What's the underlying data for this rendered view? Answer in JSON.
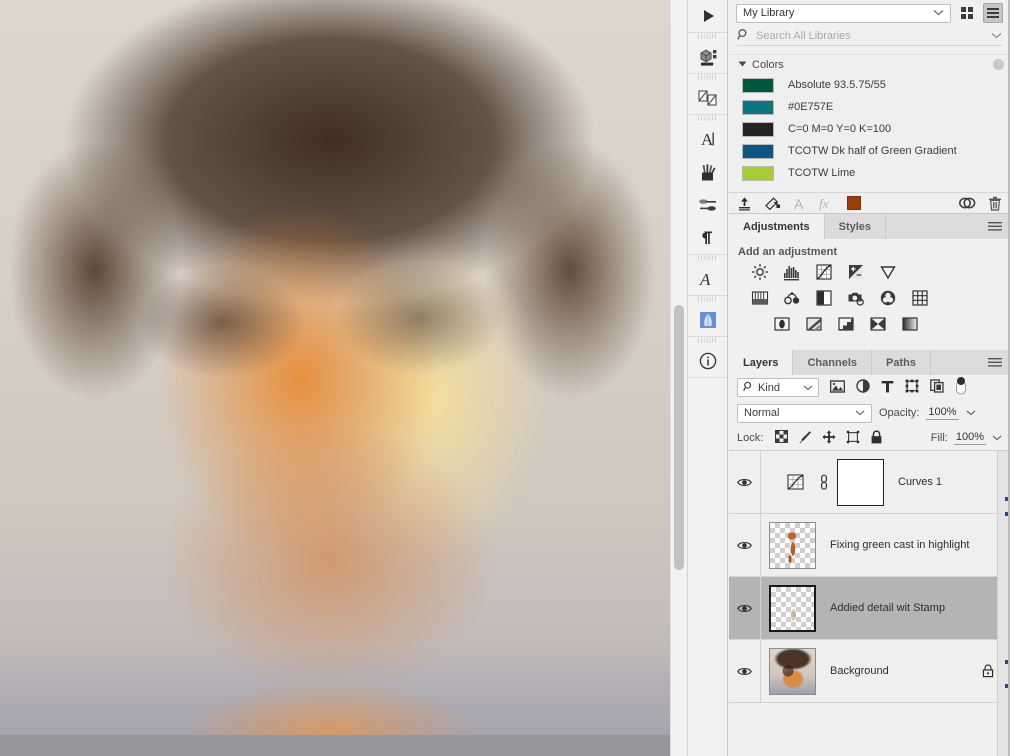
{
  "app": "Adobe Photoshop",
  "canvas": {
    "name": "portrait-photo",
    "description": "Close-up portrait of a curly-haired boy with orange/amber color cast retouching"
  },
  "icon_dock": {
    "items": [
      {
        "name": "play-button",
        "icon": "play-icon",
        "label": "Play"
      },
      {
        "name": "3d-panel",
        "icon": "cube-icon",
        "label": "3D"
      },
      {
        "name": "layer-comps-panel",
        "icon": "layer-comps-icon",
        "label": "Layer Comps"
      },
      {
        "name": "character-panel",
        "icon": "character-a-icon",
        "label": "Character"
      },
      {
        "name": "brushes-panel",
        "icon": "brushes-icon",
        "label": "Brushes"
      },
      {
        "name": "brush-settings-panel",
        "icon": "brush-settings-icon",
        "label": "Brush Settings"
      },
      {
        "name": "paragraph-panel",
        "icon": "pilcrow-icon",
        "label": "Paragraph"
      },
      {
        "name": "glyphs-panel",
        "icon": "script-a-icon",
        "label": "Glyphs"
      },
      {
        "name": "libraries-panel",
        "icon": "libraries-thumbnail-icon",
        "label": "Libraries"
      },
      {
        "name": "info-panel",
        "icon": "info-circle-icon",
        "label": "Info"
      }
    ]
  },
  "libraries": {
    "selected_library": "My Library",
    "view_grid_label": "Grid view",
    "view_list_label": "List view",
    "active_view": "list",
    "search_placeholder": "Search All Libraries",
    "group_title": "Colors",
    "group_expanded": true,
    "items": [
      {
        "label": "Absolute 93.5.75/55",
        "color": "#05563f"
      },
      {
        "label": "#0E757E",
        "color": "#0e757e"
      },
      {
        "label": "C=0 M=0 Y=0 K=100",
        "color": "#242424"
      },
      {
        "label": "TCOTW Dk half of Green Gradient",
        "color": "#105480"
      },
      {
        "label": "TCOTW Lime",
        "color": "#a8cc38"
      }
    ],
    "toolbar": {
      "upload_label": "Add content",
      "graphic_label": "Add graphic",
      "text_style_label": "Add character style",
      "layer_style_label": "Add layer style",
      "color_label": "Add fill color",
      "color_value": "#9e3d0b",
      "creative_cloud_label": "Creative Cloud",
      "delete_label": "Delete"
    }
  },
  "adjustments": {
    "tabs": [
      {
        "label": "Adjustments",
        "active": true
      },
      {
        "label": "Styles",
        "active": false
      }
    ],
    "menu_label": "Panel menu",
    "heading": "Add an adjustment",
    "row1": [
      {
        "name": "brightness-contrast-adjustment",
        "icon": "sun-icon"
      },
      {
        "name": "levels-adjustment",
        "icon": "levels-icon"
      },
      {
        "name": "curves-adjustment",
        "icon": "curves-icon"
      },
      {
        "name": "exposure-adjustment",
        "icon": "exposure-icon"
      },
      {
        "name": "vibrance-adjustment",
        "icon": "triangle-icon"
      }
    ],
    "row2": [
      {
        "name": "hue-saturation-adjustment",
        "icon": "hue-saturation-icon"
      },
      {
        "name": "color-balance-adjustment",
        "icon": "balance-scale-icon"
      },
      {
        "name": "black-white-adjustment",
        "icon": "half-square-icon"
      },
      {
        "name": "photo-filter-adjustment",
        "icon": "camera-icon"
      },
      {
        "name": "channel-mixer-adjustment",
        "icon": "color-wheel-icon"
      },
      {
        "name": "color-lookup-adjustment",
        "icon": "grid-icon"
      }
    ],
    "row3": [
      {
        "name": "invert-adjustment",
        "icon": "invert-icon"
      },
      {
        "name": "posterize-adjustment",
        "icon": "posterize-icon"
      },
      {
        "name": "threshold-adjustment",
        "icon": "threshold-icon"
      },
      {
        "name": "selective-color-adjustment",
        "icon": "selective-color-icon"
      },
      {
        "name": "gradient-map-adjustment",
        "icon": "gradient-map-icon"
      }
    ]
  },
  "layers": {
    "tabs": [
      {
        "label": "Layers",
        "active": true
      },
      {
        "label": "Channels",
        "active": false
      },
      {
        "label": "Paths",
        "active": false
      }
    ],
    "menu_label": "Panel menu",
    "filter": {
      "kind_label": "Kind",
      "icons": [
        {
          "name": "filter-pixel-layers",
          "icon": "image-icon"
        },
        {
          "name": "filter-adjustment-layers",
          "icon": "half-circle-icon"
        },
        {
          "name": "filter-type-layers",
          "icon": "type-t-icon"
        },
        {
          "name": "filter-shape-layers",
          "icon": "shape-icon"
        },
        {
          "name": "filter-smart-objects",
          "icon": "smart-object-icon"
        }
      ],
      "toggle_label": "Turn filtering on/off"
    },
    "blend_mode": "Normal",
    "opacity_label": "Opacity:",
    "opacity_value": "100%",
    "lock_label": "Lock:",
    "lock_icons": [
      {
        "name": "lock-transparent-pixels",
        "icon": "checker-icon"
      },
      {
        "name": "lock-image-pixels",
        "icon": "brush-icon"
      },
      {
        "name": "lock-position",
        "icon": "move-arrows-icon"
      },
      {
        "name": "lock-artboard-nesting",
        "icon": "artboard-icon"
      },
      {
        "name": "lock-all",
        "icon": "padlock-icon"
      }
    ],
    "fill_label": "Fill:",
    "fill_value": "100%",
    "rows": [
      {
        "name": "Curves 1",
        "type": "adjustment",
        "visible": true,
        "selected": false,
        "has_mask": true,
        "linked": true,
        "locked": false
      },
      {
        "name": "Fixing green cast in highlight",
        "type": "pixel",
        "visible": true,
        "selected": false,
        "has_mask": false,
        "linked": false,
        "locked": false
      },
      {
        "name": "Addied detail wit Stamp",
        "type": "pixel",
        "visible": true,
        "selected": true,
        "has_mask": false,
        "linked": false,
        "locked": false
      },
      {
        "name": "Background",
        "type": "pixel",
        "visible": true,
        "selected": false,
        "has_mask": false,
        "linked": false,
        "locked": true
      }
    ]
  }
}
